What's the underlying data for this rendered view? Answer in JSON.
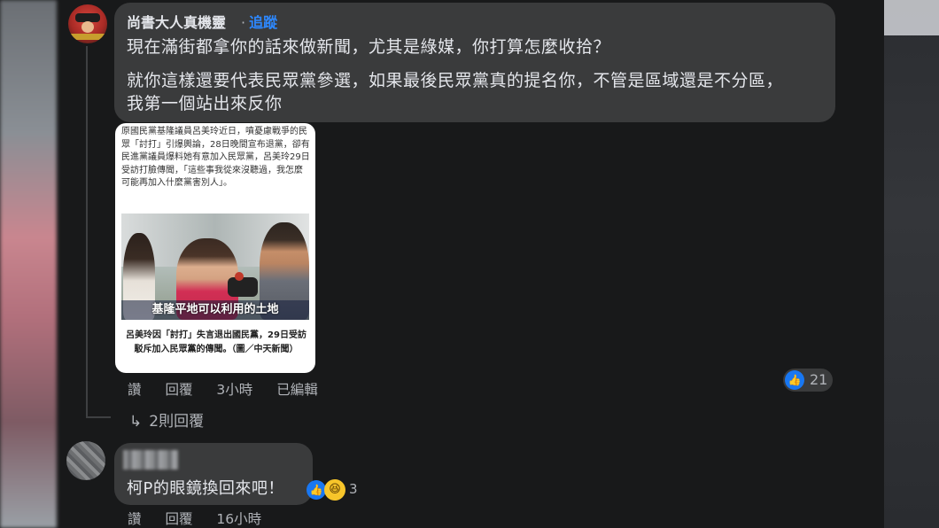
{
  "comment1": {
    "author": "尚書大人真機靈",
    "follow_label": "追蹤",
    "line1": "現在滿街都拿你的話來做新聞，尤其是綠媒，你打算怎麼收拾？",
    "line2": "就你這樣還要代表民眾黨參選，如果最後民眾黨真的提名你，不管是區域還是不分區，",
    "line3": "我第一個站出來反你",
    "news_text": "原國民黨基隆議員呂美玲近日，噴憂慮戰爭的民眾「討打」引爆輿論，28日晚間宣布退黨，卻有民進黨議員爆料她有意加入民眾黨，呂美玲29日受訪打臉傳聞，「這些事我從來沒聽過，我怎麼可能再加入什麼黨害別人」。",
    "news_subtitle": "基隆平地可以利用的土地",
    "news_caption": "呂美玲因「討打」失言退出國民黨，29日受訪駁斥加入民眾黨的傳聞。（圖／中天新聞）",
    "action_like": "讚",
    "action_reply": "回覆",
    "time": "3小時",
    "edited": "已編輯",
    "reaction_count": "21",
    "replies_arrow": "↳",
    "replies_label": "2則回覆"
  },
  "comment2": {
    "text": "柯P的眼鏡換回來吧！",
    "reaction_count": "3",
    "action_like": "讚",
    "action_reply": "回覆",
    "time": "16小時"
  },
  "colors": {
    "background": "#18191a",
    "bubble": "#3a3b3c",
    "link_blue": "#2d88ff",
    "like_blue": "#1877f2"
  },
  "icons": {
    "like": "thumbs-up-icon",
    "haha": "haha-icon",
    "reply_arrow": "reply-arrow-icon"
  }
}
